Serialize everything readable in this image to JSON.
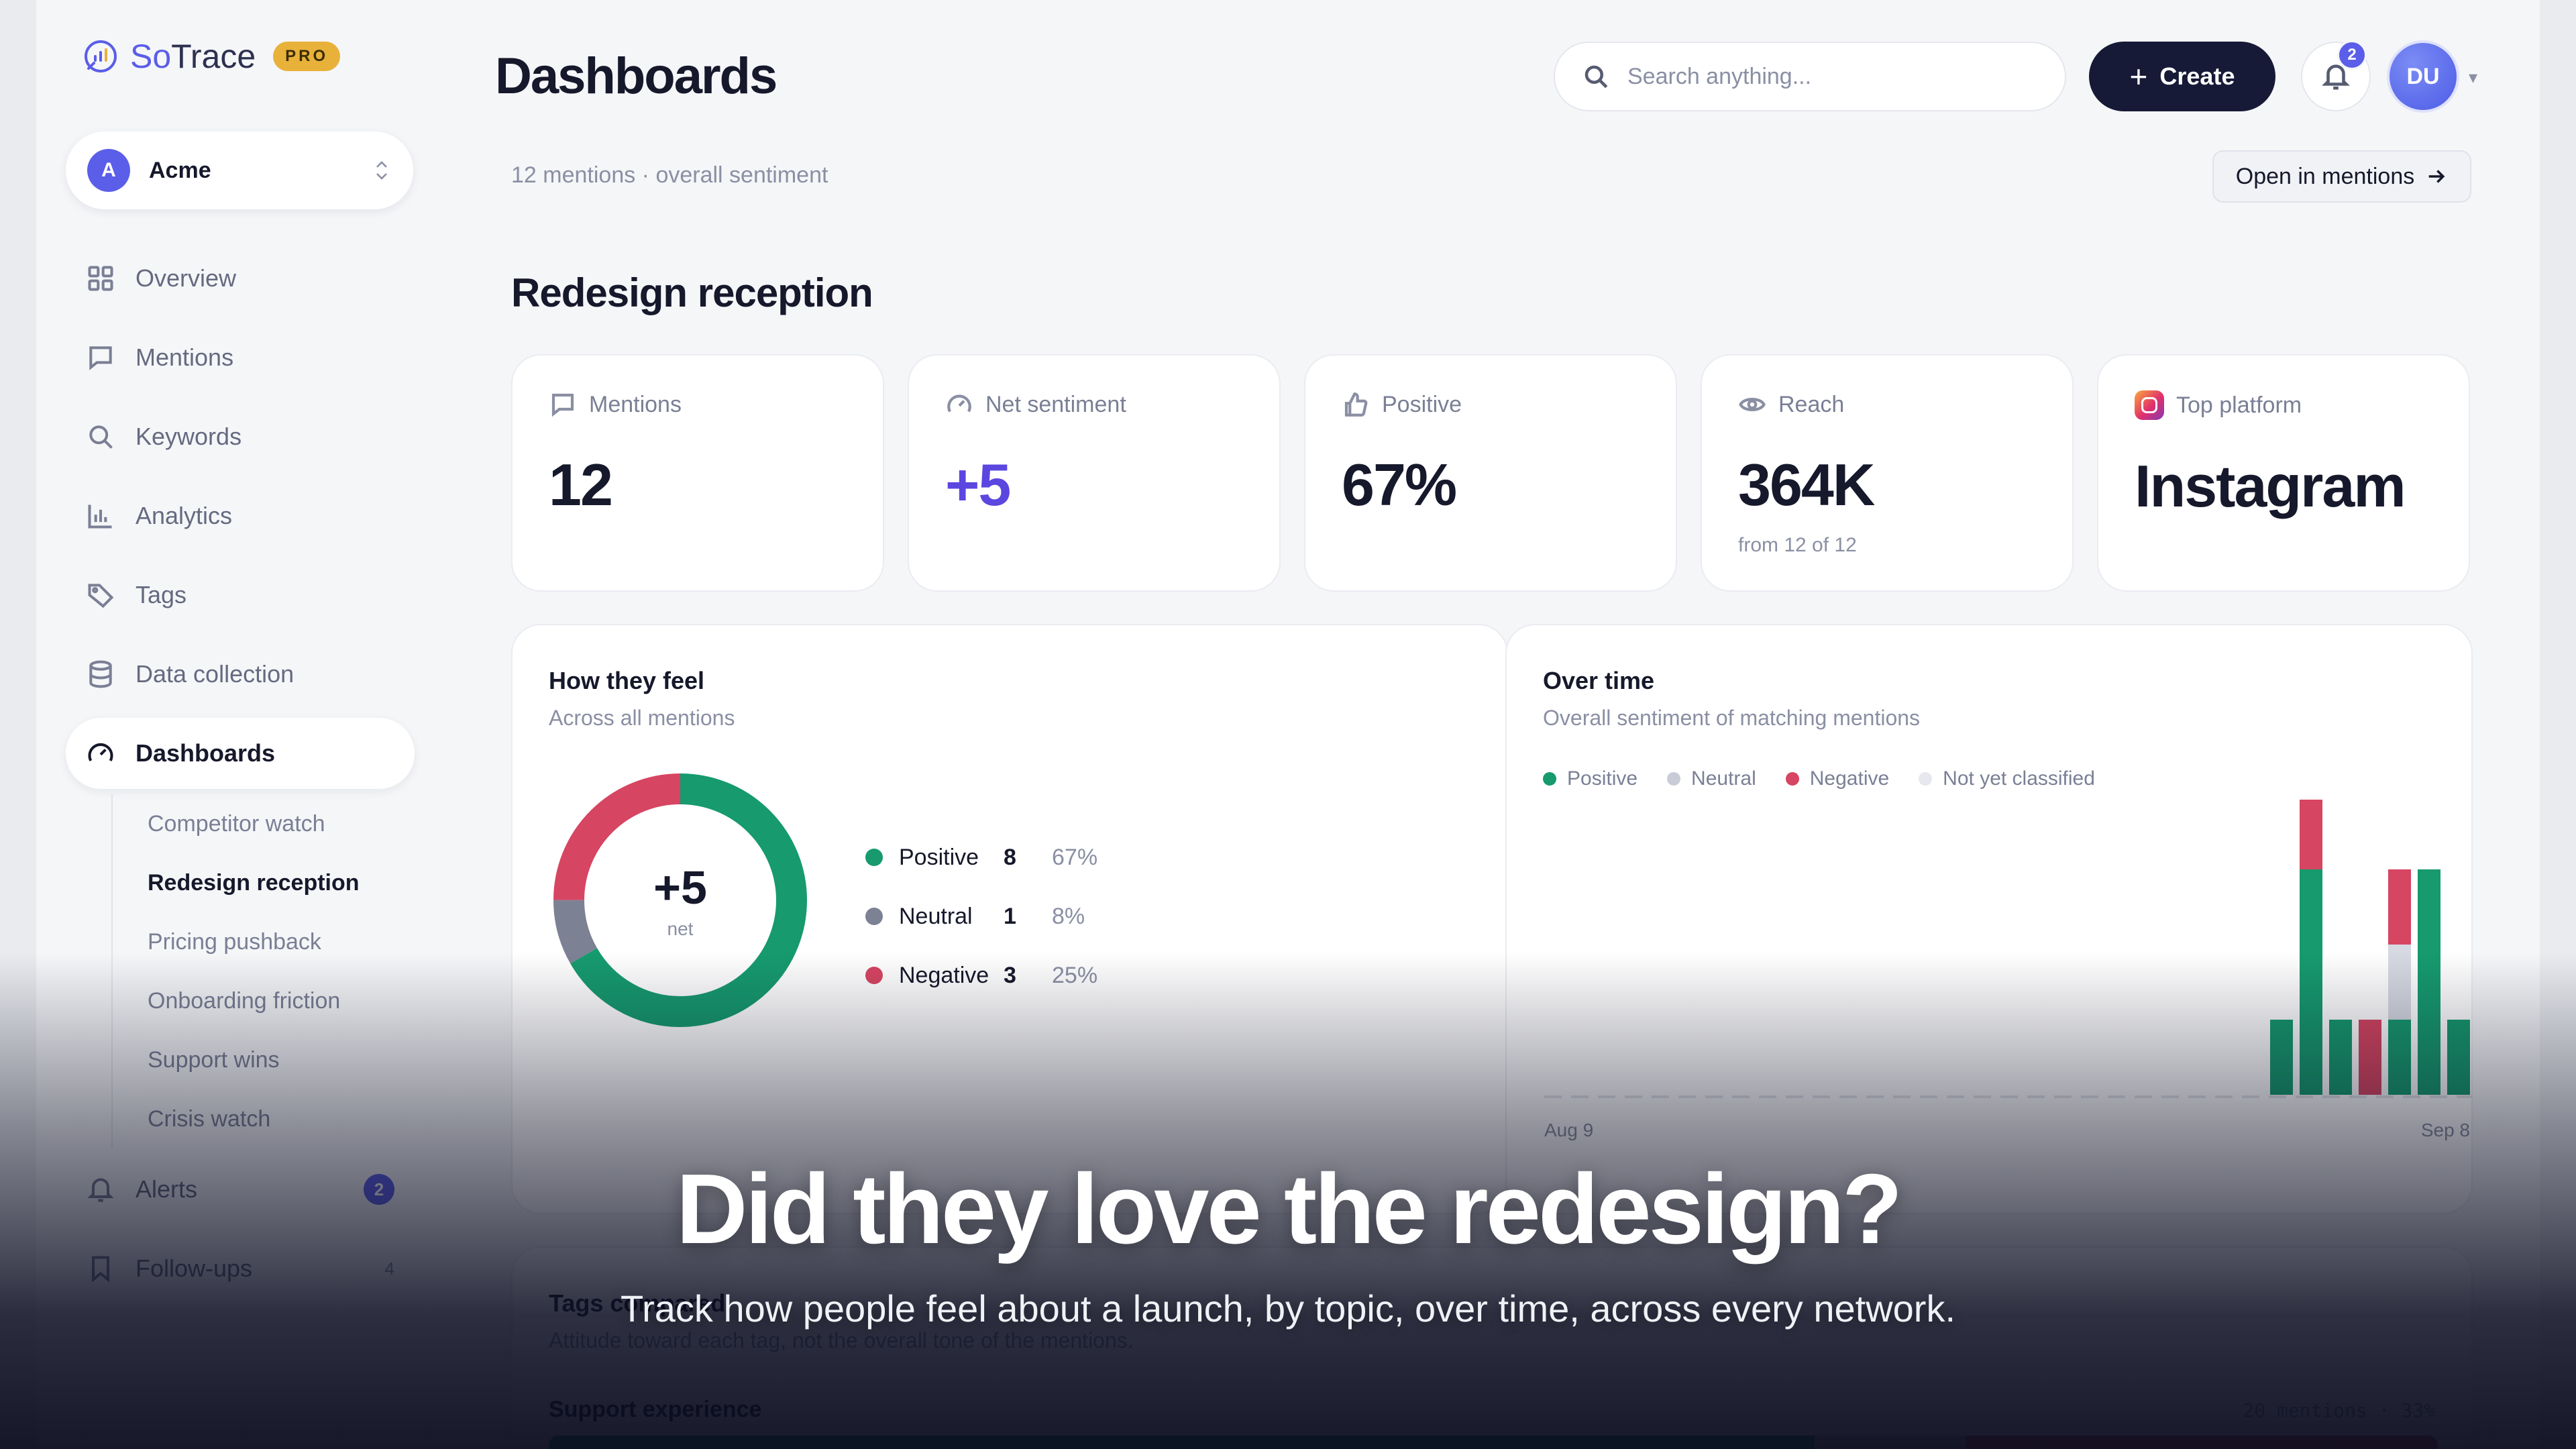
{
  "app": {
    "brand_so": "So",
    "brand_trace": "Trace",
    "plan_badge": "PRO"
  },
  "workspace": {
    "initial": "A",
    "name": "Acme"
  },
  "sidebar": {
    "items": [
      {
        "label": "Overview",
        "icon": "grid-icon"
      },
      {
        "label": "Mentions",
        "icon": "message-icon"
      },
      {
        "label": "Keywords",
        "icon": "search-icon"
      },
      {
        "label": "Analytics",
        "icon": "bar-chart-icon"
      },
      {
        "label": "Tags",
        "icon": "tag-icon"
      },
      {
        "label": "Data collection",
        "icon": "database-icon"
      },
      {
        "label": "Dashboards",
        "icon": "gauge-icon"
      },
      {
        "label": "Alerts",
        "icon": "bell-icon",
        "count": "2"
      },
      {
        "label": "Follow-ups",
        "icon": "bookmark-icon",
        "count": "4"
      }
    ],
    "dashboards": [
      "Competitor watch",
      "Redesign reception",
      "Pricing pushback",
      "Onboarding friction",
      "Support wins",
      "Crisis watch"
    ]
  },
  "header": {
    "title": "Dashboards",
    "search_placeholder": "Search anything...",
    "create_label": "Create",
    "notifications_count": "2",
    "user_initials": "DU"
  },
  "context": {
    "subtitle": "12 mentions · overall sentiment",
    "open_label": "Open in mentions"
  },
  "dashboard": {
    "title": "Redesign reception"
  },
  "stats": {
    "mentions": {
      "label": "Mentions",
      "value": "12"
    },
    "net": {
      "label": "Net sentiment",
      "value": "+5"
    },
    "positive": {
      "label": "Positive",
      "value": "67%"
    },
    "reach": {
      "label": "Reach",
      "value": "364K",
      "note": "from 12 of 12"
    },
    "platform": {
      "label": "Top platform",
      "value": "Instagram"
    }
  },
  "feel": {
    "title": "How they feel",
    "subtitle": "Across all mentions",
    "net": "+5",
    "net_label": "net",
    "rows": [
      {
        "name": "Positive",
        "count": "8",
        "pct": "67%"
      },
      {
        "name": "Neutral",
        "count": "1",
        "pct": "8%"
      },
      {
        "name": "Negative",
        "count": "3",
        "pct": "25%"
      }
    ]
  },
  "over_time": {
    "title": "Over time",
    "subtitle": "Overall sentiment of matching mentions",
    "legend": [
      "Positive",
      "Neutral",
      "Negative",
      "Not yet classified"
    ],
    "x_start": "Aug 9",
    "x_end": "Sep 8"
  },
  "tags": {
    "title": "Tags compared",
    "subtitle": "Attitude toward each tag, not the overall tone of the mentions.",
    "row_label": "Support experience",
    "row_meta": "20 mentions · 33%"
  },
  "overlay": {
    "headline": "Did they love the redesign?",
    "tagline": "Track how people feel about a launch, by topic, over time, across every network."
  },
  "colors": {
    "positive": "#169a6e",
    "neutral": "#7d8194",
    "negative": "#d64561",
    "unclassified": "#dcdee6",
    "accent": "#5b5ee8"
  },
  "chart_data": [
    {
      "type": "pie",
      "title": "How they feel",
      "categories": [
        "Positive",
        "Neutral",
        "Negative"
      ],
      "values": [
        8,
        1,
        3
      ],
      "percent": [
        67,
        8,
        25
      ]
    },
    {
      "type": "bar",
      "title": "Over time",
      "stacked": true,
      "xlabel": "",
      "ylabel": "",
      "x_range": [
        "Aug 9",
        "Sep 8"
      ],
      "grid": false,
      "legend": "top-left",
      "series": [
        {
          "name": "Positive",
          "values": [
            1,
            3,
            1,
            0,
            1,
            3,
            1
          ]
        },
        {
          "name": "Neutral",
          "values": [
            0,
            0,
            0,
            0,
            1,
            0,
            0
          ]
        },
        {
          "name": "Negative",
          "values": [
            0,
            1,
            0,
            1,
            1,
            0,
            0
          ]
        }
      ]
    }
  ]
}
